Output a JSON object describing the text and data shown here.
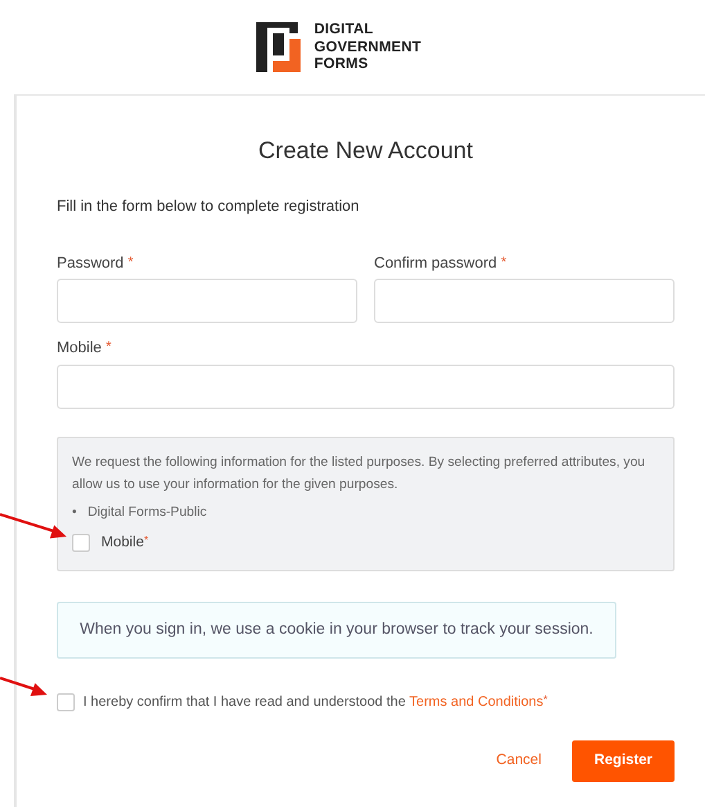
{
  "logo": {
    "lines": [
      "DIGITAL",
      "GOVERNMENT",
      "FORMS"
    ]
  },
  "title": "Create New Account",
  "intro": "Fill in the form below to complete registration",
  "fields": [
    {
      "label": "Password",
      "marker": "*",
      "kind": "half"
    },
    {
      "label": "Confirm password",
      "marker": "*",
      "kind": "half"
    },
    {
      "label": "Mobile",
      "marker": "*",
      "kind": "full"
    }
  ],
  "consent": {
    "text": "We request the following information for the listed purposes. By selecting preferred attributes, you allow us to use your information for the given purposes.",
    "purpose": "Digital Forms-Public",
    "bullet": "•",
    "attribute": {
      "label": "Mobile",
      "marker": "*",
      "checked": false
    }
  },
  "cookie_notice": "When you sign in, we use a cookie in your browser to track your session.",
  "terms": {
    "text": "I hereby confirm that I have read and understood the",
    "link": "Terms and Conditions",
    "marker": "*",
    "checked": false
  },
  "buttons": [
    {
      "label": "Cancel",
      "kind": "link"
    },
    {
      "label": "Register",
      "kind": "primary"
    }
  ],
  "annotations": [
    {
      "kind": "arrow"
    },
    {
      "kind": "arrow"
    }
  ]
}
